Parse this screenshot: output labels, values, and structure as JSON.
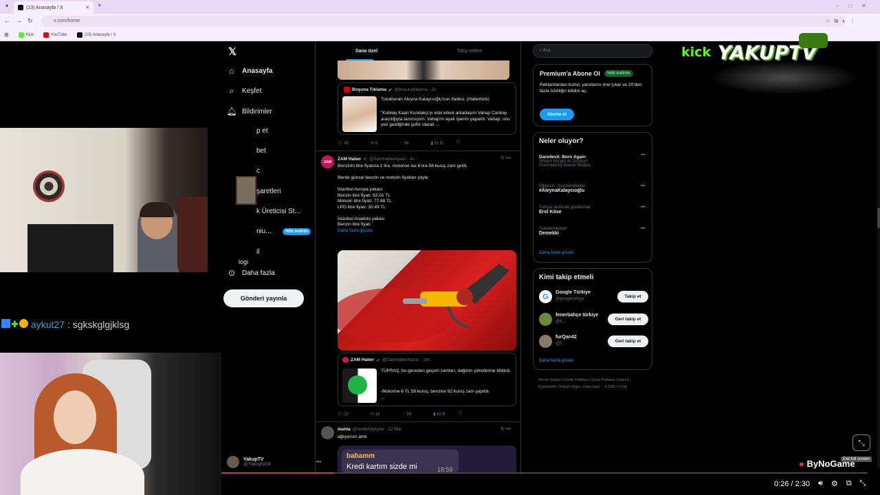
{
  "browser": {
    "tab_title": "(13) Anasayfa / X",
    "url": "x.com/home",
    "bookmarks": [
      "Kick",
      "YouTube",
      "(13) Anasayfa / X"
    ]
  },
  "nav": {
    "items": [
      "Anasayfa",
      "Keşfet",
      "Bildirimler",
      "p et",
      "bet",
      "c",
      "şaretleri",
      "k Üreticisi St...",
      "niu...",
      "il",
      "logi",
      "Daha fazla"
    ],
    "premium_badge": "%50 indirim",
    "post_button": "Gönderi yayınla",
    "profile_name": "YakupTV",
    "profile_handle": "@Yakuptv04"
  },
  "feed": {
    "tabs": [
      "Sana özel",
      "Takip edilen"
    ],
    "quote1": {
      "name": "Boşuna Tıklama",
      "handle": "@bosunatiklama · 2s",
      "title": "Tutuklanan Aleyna Kalaycıoğlu'nun ifadesi. (Habertürk)",
      "body": "\"Kubilay Kaan Kundakçı'yı eski erkek arkadaşım Vahap Canbay aracılığıyla tanımıştım. Vahap'ın ayak işlerini yapardı. Vahap, onu yeri geldiğinde şoför olarak ..."
    },
    "stats1": [
      "45",
      "5",
      "99",
      "81 B"
    ],
    "tweet2": {
      "name": "ZAM Haber",
      "handle": "@ZamHaberAjans · 4s",
      "lines": [
        "Benzinin litre fiyatına 1 lira, motorine ise 6 lira 58 kuruş zam geldi.",
        "",
        "İllerde güncel benzin ve motorin fiyatları şöyle:",
        "",
        "İstanbul Avrupa yakası",
        "Benzin litre fiyatı: 63.01 TL",
        "Motorin litre fiyatı: 77.68 TL",
        "LPG litre fiyatı: 30.49 TL",
        "",
        "İstanbul Anadolu yakası",
        "Benzin litre fiyatı:"
      ],
      "show_more": "Daha fazla göster"
    },
    "quote2": {
      "name": "ZAM Haber",
      "handle": "@ZamHaberAjans · 18s",
      "body": "TÜPRAŞ, bu geceden geçerli zamları, dağıtım şirketlerine bildirdi.",
      "body2": "-Motorine 6 TL 58 kuruş, benzine 92 kuruş zam yapıldı.",
      "body3": "..."
    },
    "stats2": [
      "32",
      "14",
      "99",
      "43 B"
    ],
    "tweet3": {
      "name": "damla",
      "handle": "@writtenbykylie · 22 Mar",
      "text": "ağlıyorum amk",
      "chat_name": "babamm",
      "chat_text": "Kredi kartım sizde mi",
      "chat_time": "18:59"
    }
  },
  "sidebar": {
    "search_placeholder": "Ara",
    "premium": {
      "title": "Premium'a Abone Ol",
      "badge": "%50 indirim",
      "body": "Reklamlardan kurtul, yanıtlarını öne çıkar ve 20'den fazla özelliğin kilidini aç.",
      "button": "Abone ol"
    },
    "trends": {
      "title": "Neler oluyor?",
      "items": [
        {
          "meta": "Daredevil: Born Again",
          "title": "Stream tonight on Disney+",
          "extra": "Promoted by Marvel Studios"
        },
        {
          "meta": "Eğlence · Gündemdekiler",
          "title": "#AleynaKalaycıoğlu",
          "extra": ""
        },
        {
          "meta": "Türkiye tarihinde gündemde",
          "title": "Erol Köse",
          "extra": ""
        },
        {
          "meta": "Gündemdekiler",
          "title": "Demekki",
          "extra": ""
        }
      ],
      "show_more": "Daha fazla göster"
    },
    "who_to_follow": {
      "title": "Kimi takip etmeli",
      "accounts": [
        {
          "name": "Google Türkiye",
          "handle": "@googleturkiye",
          "button": "Takip et"
        },
        {
          "name": "fenerbahçe türkiye",
          "handle": "@E...",
          "button": "Geri takip et"
        },
        {
          "name": "furQan42",
          "handle": "@F...",
          "button": "Geri takip et"
        }
      ],
      "show_more": "Daha fazla göster"
    },
    "footer": [
      "Hizmet Şartları",
      "Gizlilik Politikası",
      "Çerez Politikası",
      "Imprint",
      "Erişilebilirlik",
      "Reklam bilgisi",
      "Daha fazla ...",
      "© 2025 X Corp."
    ]
  },
  "overlay": {
    "chat_user": "aykut27",
    "chat_message": ": sgkskglgjklsg",
    "logo_kick": "kick",
    "logo_name": "YAKUPTV",
    "sponsor": "ByNoGame",
    "tooltip": "Exit full screen",
    "time": "0:26 / 2:30",
    "progress": 0.173
  },
  "colors": {
    "accent": "#1d9bf0",
    "kick_green": "#53fc18",
    "progress": "#e33333"
  }
}
